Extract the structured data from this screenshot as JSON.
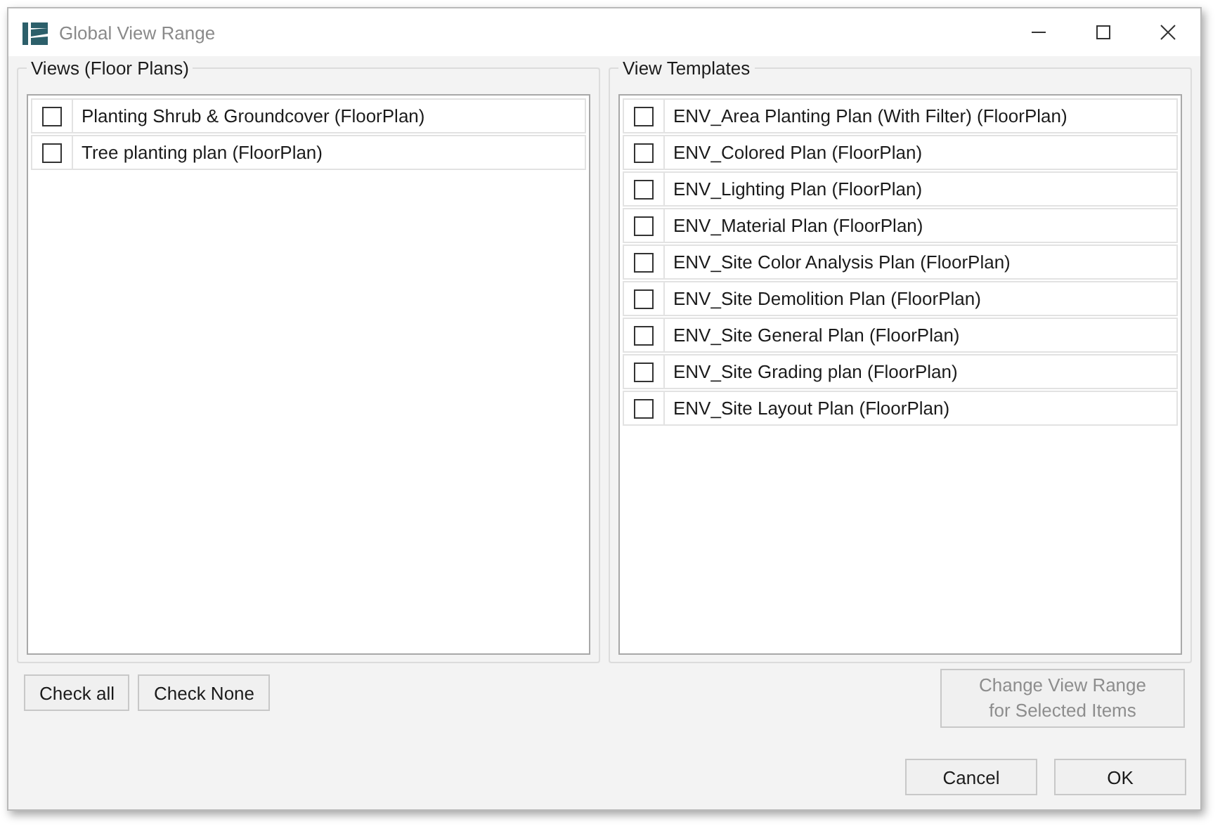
{
  "window": {
    "title": "Global View Range"
  },
  "views": {
    "label": "Views (Floor Plans)",
    "items": [
      {
        "label": "Planting Shrub & Groundcover (FloorPlan)",
        "checked": false
      },
      {
        "label": "Tree planting plan (FloorPlan)",
        "checked": false
      }
    ]
  },
  "templates": {
    "label": "View Templates",
    "items": [
      {
        "label": "ENV_Area Planting Plan (With Filter) (FloorPlan)",
        "checked": false
      },
      {
        "label": "ENV_Colored Plan (FloorPlan)",
        "checked": false
      },
      {
        "label": "ENV_Lighting Plan (FloorPlan)",
        "checked": false
      },
      {
        "label": "ENV_Material Plan (FloorPlan)",
        "checked": false
      },
      {
        "label": "ENV_Site Color Analysis Plan (FloorPlan)",
        "checked": false
      },
      {
        "label": "ENV_Site Demolition Plan (FloorPlan)",
        "checked": false
      },
      {
        "label": "ENV_Site General Plan (FloorPlan)",
        "checked": false
      },
      {
        "label": "ENV_Site Grading plan (FloorPlan)",
        "checked": false
      },
      {
        "label": "ENV_Site Layout Plan (FloorPlan)",
        "checked": false
      }
    ]
  },
  "check_buttons": [
    "Check all",
    "Check None"
  ],
  "change_button": {
    "label": "Change View Range for Selected Items",
    "disabled": true
  },
  "dialog_buttons": [
    "Cancel",
    "OK"
  ]
}
